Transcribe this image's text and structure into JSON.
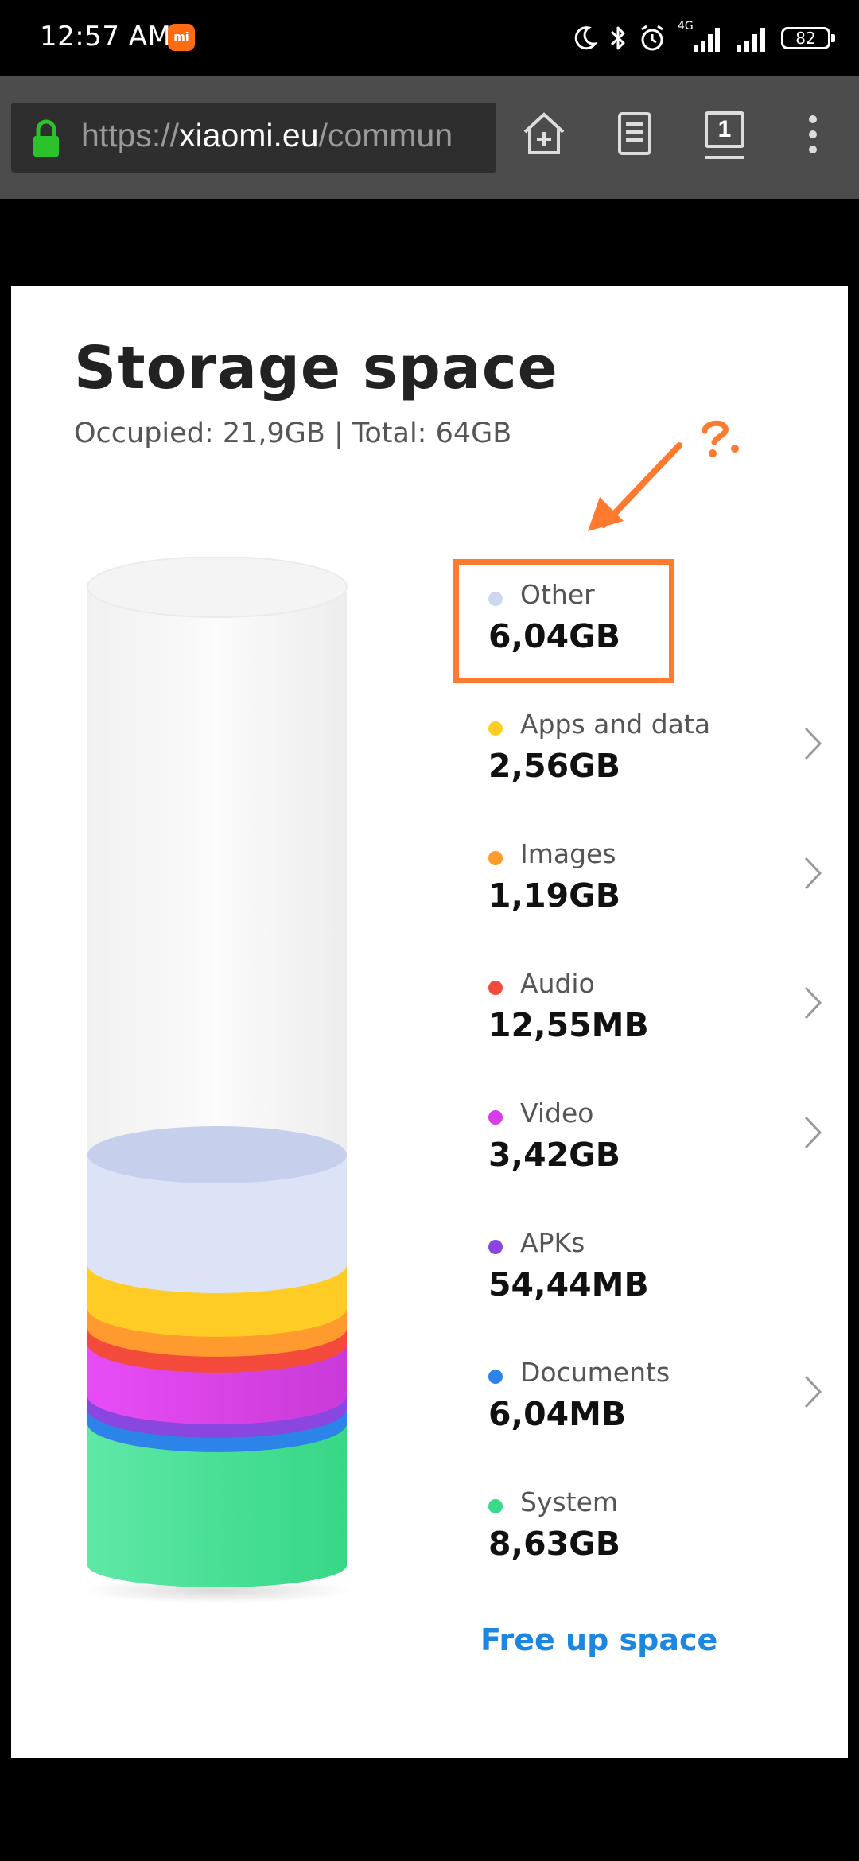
{
  "status_bar": {
    "time": "12:57 AM",
    "app_badge": "mi",
    "network_label": "4G",
    "battery": "82"
  },
  "browser": {
    "url_scheme": "https://",
    "url_host": "xiaomi.eu",
    "url_path": "/commun",
    "tab_count": "1",
    "icons": [
      "lock-icon",
      "home-add-icon",
      "reader-icon",
      "tabs-icon",
      "more-icon"
    ]
  },
  "storage": {
    "title": "Storage space",
    "subtitle": "Occupied: 21,9GB | Total: 64GB",
    "annotation_mark": "?",
    "items": [
      {
        "name": "Other",
        "value": "6,04GB",
        "color": "#cfd7ee",
        "chevron": false
      },
      {
        "name": "Apps and data",
        "value": "2,56GB",
        "color": "#ffcc26",
        "chevron": true
      },
      {
        "name": "Images",
        "value": "1,19GB",
        "color": "#ff9a2e",
        "chevron": true
      },
      {
        "name": "Audio",
        "value": "12,55MB",
        "color": "#f44a3c",
        "chevron": true
      },
      {
        "name": "Video",
        "value": "3,42GB",
        "color": "#d83be8",
        "chevron": true
      },
      {
        "name": "APKs",
        "value": "54,44MB",
        "color": "#8a46e0",
        "chevron": false
      },
      {
        "name": "Documents",
        "value": "6,04MB",
        "color": "#2d84e8",
        "chevron": true
      },
      {
        "name": "System",
        "value": "8,63GB",
        "color": "#3bd98a",
        "chevron": false
      }
    ],
    "free_up_label": "Free up space",
    "accent_color": "#1d86e0",
    "annotation_color": "#ff7a2e"
  }
}
